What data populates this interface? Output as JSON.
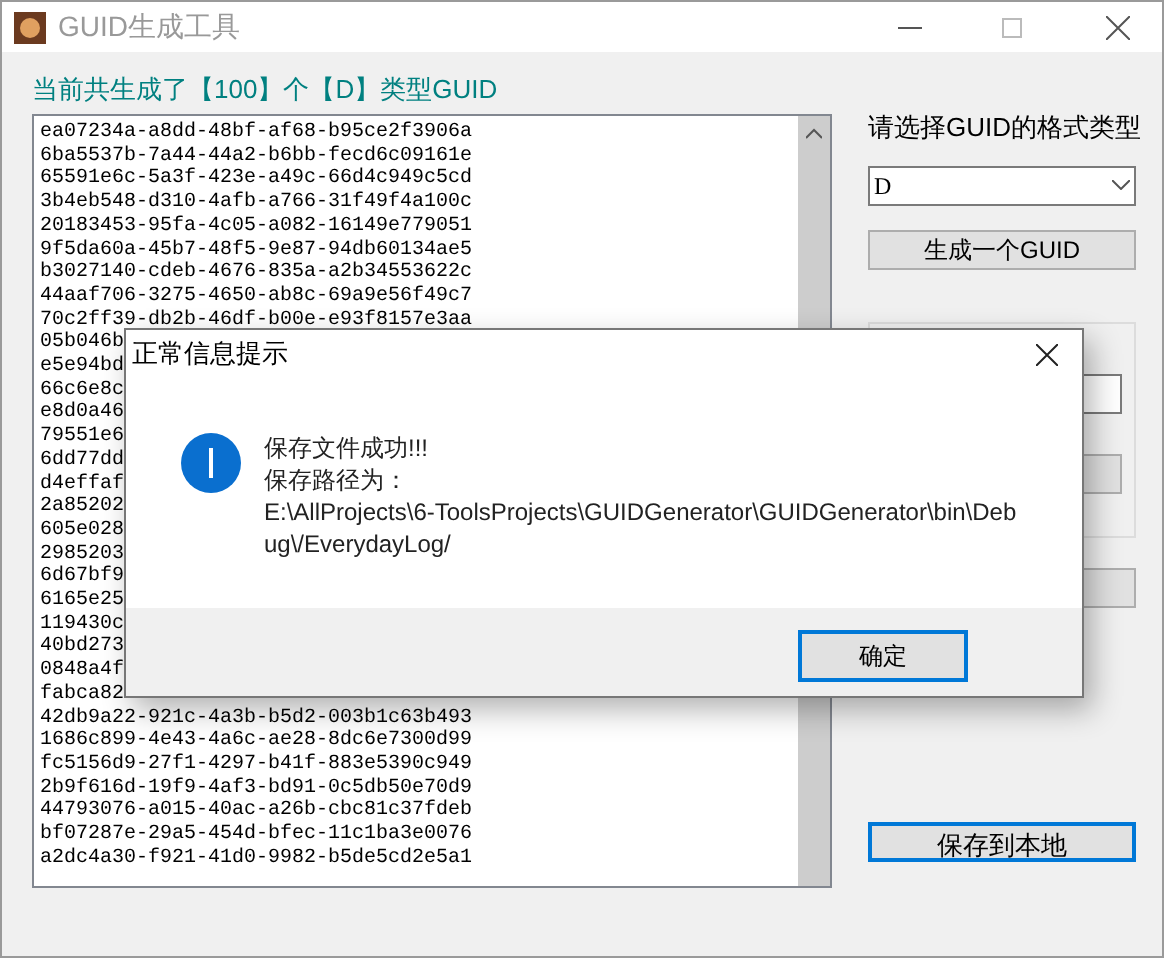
{
  "window": {
    "title": "GUID生成工具"
  },
  "summary": "当前共生成了【100】个【D】类型GUID",
  "guid_list": [
    "ea07234a-a8dd-48bf-af68-b95ce2f3906a",
    "6ba5537b-7a44-44a2-b6bb-fecd6c09161e",
    "65591e6c-5a3f-423e-a49c-66d4c949c5cd",
    "3b4eb548-d310-4afb-a766-31f49f4a100c",
    "20183453-95fa-4c05-a082-16149e779051",
    "9f5da60a-45b7-48f5-9e87-94db60134ae5",
    "b3027140-cdeb-4676-835a-a2b34553622c",
    "44aaf706-3275-4650-ab8c-69a9e56f49c7",
    "70c2ff39-db2b-46df-b00e-e93f8157e3aa",
    "05b046b",
    "e5e94bd",
    "66c6e8c",
    "e8d0a46",
    "79551e6",
    "6dd77dd",
    "d4effaf",
    "2a85202",
    "605e028",
    "2985203",
    "6d67bf9",
    "6165e25",
    "119430c",
    "40bd273",
    "0848a4f",
    "fabca82",
    "42db9a22-921c-4a3b-b5d2-003b1c63b493",
    "1686c899-4e43-4a6c-ae28-8dc6e7300d99",
    "fc5156d9-27f1-4297-b41f-883e5390c949",
    "2b9f616d-19f9-4af3-bd91-0c5db50e70d9",
    "44793076-a015-40ac-a26b-cbc81c37fdeb",
    "bf07287e-29a5-454d-bfec-11c1ba3e0076",
    "a2dc4a30-f921-41d0-9982-b5de5cd2e5a1"
  ],
  "format_label": "请选择GUID的格式类型",
  "format_select": {
    "value": "D"
  },
  "generate_button": "生成一个GUID",
  "save_button": {
    "label": "保存到本地",
    "focused": true
  },
  "dialog": {
    "title": "正常信息提示",
    "lines": [
      "保存文件成功!!!",
      "保存路径为：",
      "E:\\AllProjects\\6-ToolsProjects\\GUIDGenerator\\GUIDGenerator\\bin\\Deb",
      "ug\\/EverydayLog/"
    ],
    "ok_button": "确定"
  }
}
